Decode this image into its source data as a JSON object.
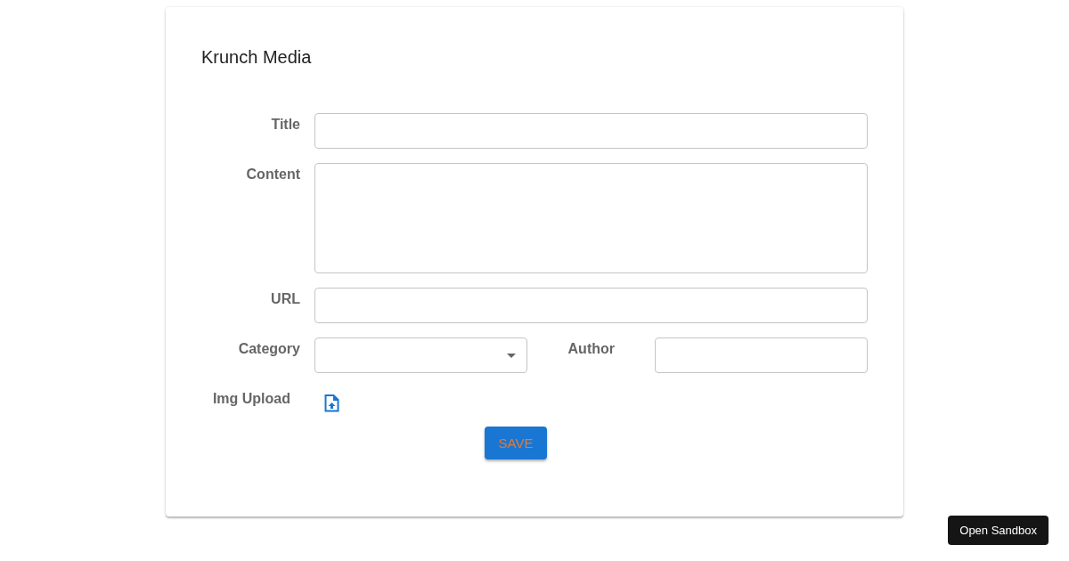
{
  "card": {
    "title": "Krunch Media"
  },
  "fields": [
    {
      "kind": "text",
      "label": "Title"
    },
    {
      "kind": "textarea",
      "label": "Content"
    },
    {
      "kind": "text",
      "label": "URL"
    }
  ],
  "category": {
    "label": "Category"
  },
  "author": {
    "label": "Author"
  },
  "upload": {
    "label": "Img Upload"
  },
  "save_button": "SAVE",
  "sandbox_button": "Open Sandbox"
}
